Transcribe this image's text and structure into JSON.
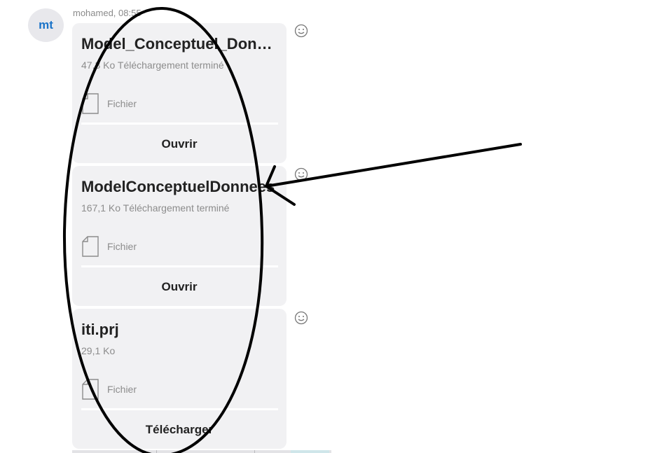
{
  "message": {
    "avatar_initials": "mt",
    "sender_line": "mohamed, 08:55"
  },
  "attachments": [
    {
      "file_name": "Model_Conceptuel_Donnees",
      "meta": "47,3 Ko Téléchargement terminé",
      "file_type_label": "Fichier",
      "action_label": "Ouvrir"
    },
    {
      "file_name": "ModelConceptuelDonnees",
      "meta": "167,1 Ko Téléchargement terminé",
      "file_type_label": "Fichier",
      "action_label": "Ouvrir"
    },
    {
      "file_name": "iti.prj",
      "meta": "29,1 Ko",
      "file_type_label": "Fichier",
      "action_label": "Télécharger"
    }
  ],
  "icons": {
    "reaction": "smiley-face-icon",
    "file": "file-icon"
  },
  "colors": {
    "avatar_text": "#1a73c8",
    "card_background": "#f1f1f3",
    "annotation": "#000000"
  }
}
